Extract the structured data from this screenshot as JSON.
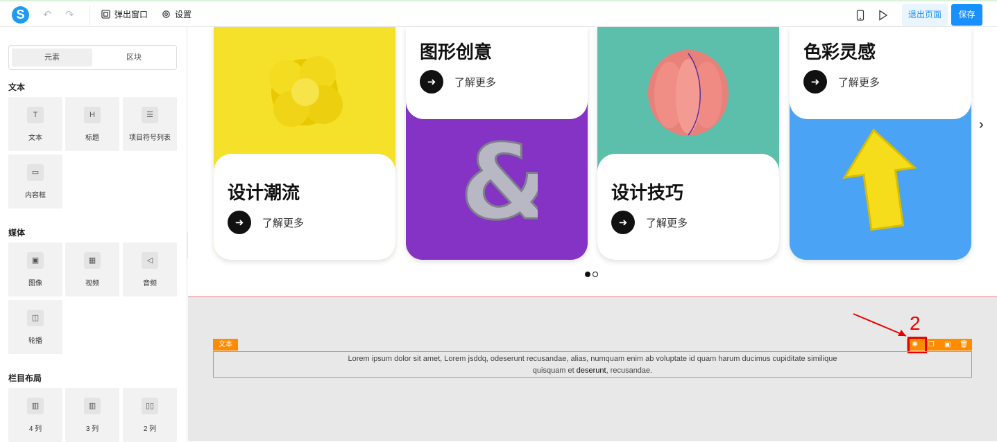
{
  "toolbar": {
    "logo": "S",
    "undo_icon": "undo-icon",
    "redo_icon": "redo-icon",
    "popup_label": "弹出窗口",
    "settings_label": "设置",
    "exit_label": "退出页面",
    "save_label": "保存"
  },
  "sidebar": {
    "tabs": [
      "元素",
      "区块"
    ],
    "sections": [
      {
        "title": "文本",
        "items": [
          {
            "label": "文本",
            "icon": "T"
          },
          {
            "label": "标题",
            "icon": "H"
          },
          {
            "label": "项目符号列表",
            "icon": "☰"
          },
          {
            "label": "内容框",
            "icon": "▭"
          }
        ]
      },
      {
        "title": "媒体",
        "items": [
          {
            "label": "图像",
            "icon": "▣"
          },
          {
            "label": "视频",
            "icon": "▦"
          },
          {
            "label": "音频",
            "icon": "◁"
          },
          {
            "label": "轮播",
            "icon": "◫"
          }
        ]
      },
      {
        "title": "栏目布局",
        "items": [
          {
            "label": "4 列",
            "icon": "▥"
          },
          {
            "label": "3 列",
            "icon": "▥"
          },
          {
            "label": "2 列",
            "icon": "▯▯"
          }
        ]
      }
    ]
  },
  "cards": [
    {
      "title": "设计潮流",
      "more": "了解更多",
      "color": "#f5e02a"
    },
    {
      "title": "图形创意",
      "more": "了解更多",
      "color": "#8433c4"
    },
    {
      "title": "设计技巧",
      "more": "了解更多",
      "color": "#5cbfac"
    },
    {
      "title": "色彩灵感",
      "more": "了解更多",
      "color": "#4aa3f5"
    }
  ],
  "text_block": {
    "tag": "文本",
    "line1": "Lorem ipsum dolor sit amet, Lorem jsddq, odeserunt recusandae, alias, numquam enim ab voluptate id quam harum ducimus cupiditate similique",
    "line2_a": "quisquam et ",
    "line2_b": "deserunt",
    "line2_c": ", recusandae."
  },
  "annotation": {
    "number": "2",
    "color": "#e00000"
  }
}
